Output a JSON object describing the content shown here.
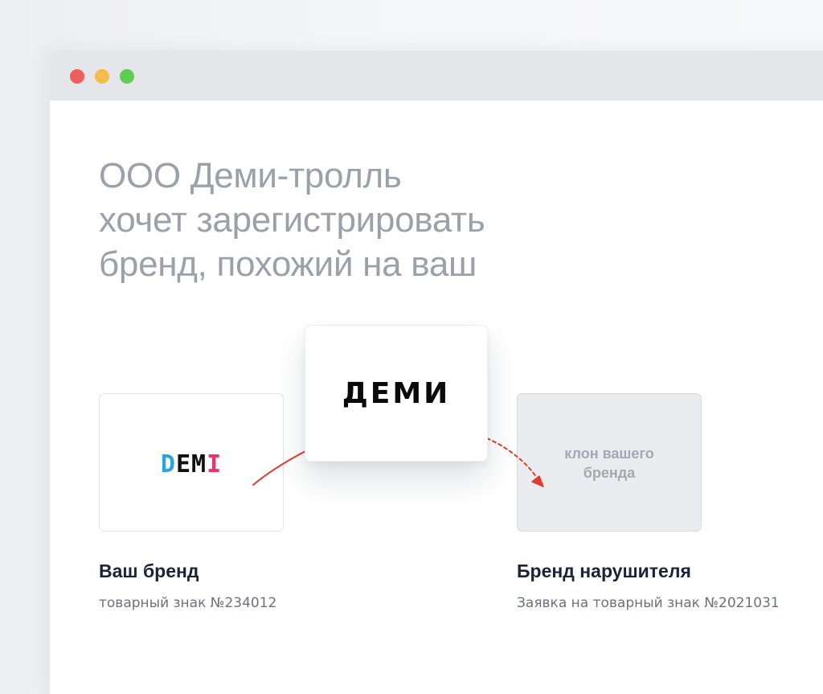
{
  "window": {
    "controls": {
      "close": "close-button",
      "minimize": "minimize-button",
      "zoom": "zoom-button"
    }
  },
  "headline": {
    "line1": "ООО Деми-тролль",
    "line2": "хочет зарегистрировать",
    "line3": "бренд, похожий на ваш"
  },
  "your_brand": {
    "logo": {
      "d": "D",
      "e": "E",
      "m": "M",
      "i": "I"
    },
    "title": "Ваш бренд",
    "subtitle": "товарный знак №234012"
  },
  "copied_mark": {
    "logo": "ДЕМИ"
  },
  "infringer": {
    "clone_line1": "клон вашего",
    "clone_line2": "бренда",
    "title": "Бренд нарушителя",
    "subtitle": "Заявка на товарный знак №2021031"
  },
  "colors": {
    "arrow": "#e23b2f",
    "logo_d": "#29a4df",
    "logo_i": "#e8346c",
    "headline": "#9ba1a9"
  }
}
